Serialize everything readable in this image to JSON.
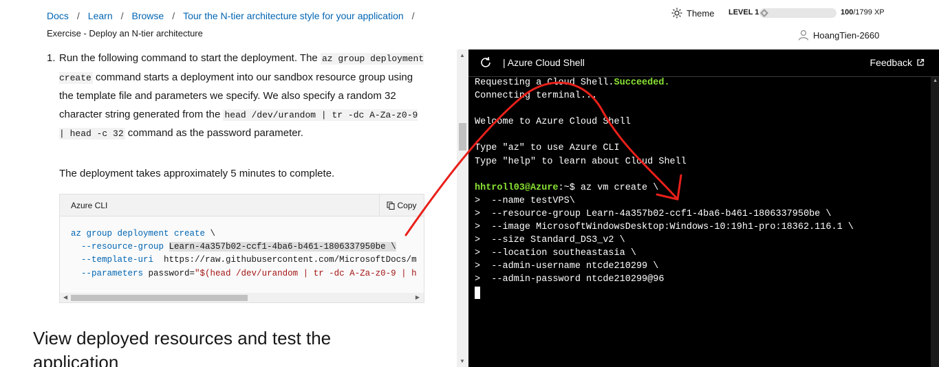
{
  "breadcrumb": {
    "items": [
      "Docs",
      "Learn",
      "Browse",
      "Tour the N-tier architecture style for your application"
    ],
    "current": "Exercise - Deploy an N-tier architecture"
  },
  "header": {
    "theme_label": "Theme",
    "level_label": "LEVEL 1",
    "xp_current": "100",
    "xp_total": "/1799 XP",
    "xp_progress": 0.056,
    "username": "HoangTien-2660"
  },
  "content": {
    "step_number": "1.",
    "step_text": {
      "t1": "Run the following command to start the deployment. The ",
      "c1": "az group deployment create",
      "t2": " command starts a deployment into our sandbox resource group using the template file and parameters we specify. We also specify a random 32 character string generated from the ",
      "c2": "head /dev/urandom | tr -dc A-Za-z0-9 | head -c 32",
      "t3": " command as the password parameter."
    },
    "duration_text": "The deployment takes approximately 5 minutes to complete.",
    "code_lang": "Azure CLI",
    "copy_label": "Copy",
    "code": {
      "l1a": "az group deployment create",
      "l1b": " \\",
      "l2a": "  --resource-group ",
      "l2b": "Learn-4a357b02-ccf1-4ba6-b461-1806337950be \\",
      "l3a": "  --template-uri",
      "l3b": "  https://raw.githubusercontent.com/MicrosoftDocs/m",
      "l4a": "  --parameters",
      "l4b": " password=",
      "l4c": "\"$(head /dev/urandom | tr -dc A-Za-z0-9 | h"
    },
    "section_heading": "View deployed resources and test the application"
  },
  "shell": {
    "title": "| Azure Cloud Shell",
    "feedback_label": "Feedback",
    "lines": {
      "l1a": "Requesting a Cloud Shell.",
      "l1b": "Succeeded.",
      "l2": "Connecting terminal...",
      "l3": "",
      "l4": "Welcome to Azure Cloud Shell",
      "l5": "",
      "l6": "Type \"az\" to use Azure CLI",
      "l7": "Type \"help\" to learn about Cloud Shell",
      "l8": "",
      "l9_prompt": "hhtroll03@Azure",
      "l9_rest": ":~$ az vm create \\",
      "l10": ">  --name testVPS\\",
      "l11": ">  --resource-group Learn-4a357b02-ccf1-4ba6-b461-1806337950be \\",
      "l12": ">  --image MicrosoftWindowsDesktop:Windows-10:19h1-pro:18362.116.1 \\",
      "l13": ">  --size Standard_DS3_v2 \\",
      "l14": ">  --location southeastasia \\",
      "l15": ">  --admin-username ntcde210299 \\",
      "l16": ">  --admin-password ntcde210299@96"
    }
  },
  "colors": {
    "link": "#0065b3",
    "success": "#8ae234",
    "annotation": "#e8201a"
  }
}
